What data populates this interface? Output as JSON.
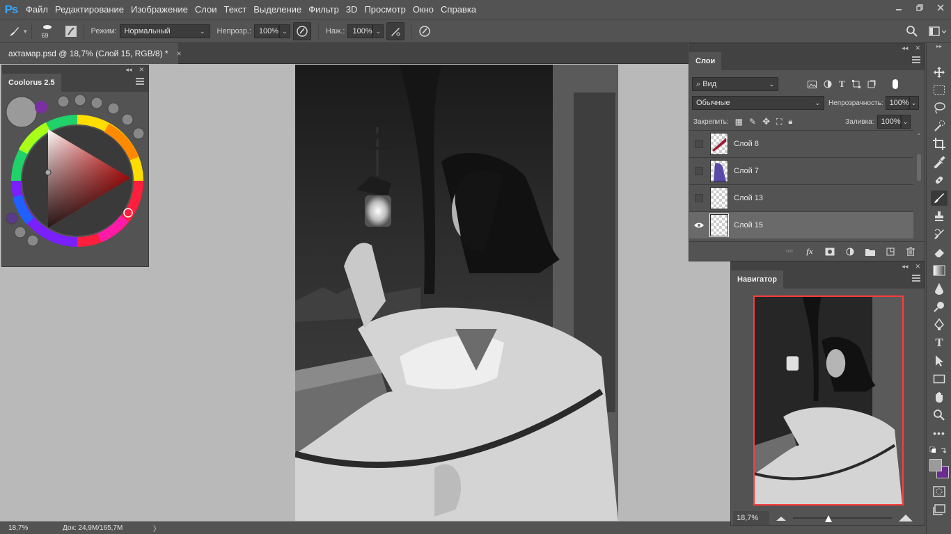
{
  "app": {
    "logo": "Ps",
    "menu": [
      "Файл",
      "Редактирование",
      "Изображение",
      "Слои",
      "Текст",
      "Выделение",
      "Фильтр",
      "3D",
      "Просмотр",
      "Окно",
      "Справка"
    ],
    "window_controls": [
      "minimize",
      "restore",
      "close"
    ]
  },
  "options_bar": {
    "brush_size": "69",
    "mode_label": "Режим:",
    "mode_value": "Нормальный",
    "opacity_label": "Непрозр.:",
    "opacity_value": "100%",
    "flow_label": "Наж.:",
    "flow_value": "100%"
  },
  "document": {
    "tab_title": "ахтамар.psd @ 18,7% (Слой 15, RGB/8) *",
    "close": "×"
  },
  "status_bar": {
    "zoom": "18,7%",
    "doc_size": "Док: 24,9M/165,7M",
    "arrow": "〉"
  },
  "coolorus": {
    "tab": "Coolorus 2.5",
    "current_color": "#9a9a9a",
    "secondary_color": "#7a2fa0"
  },
  "layers_panel": {
    "tab": "Слои",
    "filter_label": "Вид",
    "blend_mode": "Обычные",
    "opacity_label": "Непрозрачность:",
    "opacity_value": "100%",
    "lock_label": "Закрепить:",
    "fill_label": "Заливка:",
    "fill_value": "100%",
    "layers": [
      {
        "name": "Слой 8",
        "visible": false,
        "selected": false,
        "thumb": "red-stroke"
      },
      {
        "name": "Слой 7",
        "visible": false,
        "selected": false,
        "thumb": "blue-figure"
      },
      {
        "name": "Слой 13",
        "visible": false,
        "selected": false,
        "thumb": "transparent"
      },
      {
        "name": "Слой 15",
        "visible": true,
        "selected": true,
        "thumb": "transparent"
      }
    ]
  },
  "navigator": {
    "tab": "Навигатор",
    "zoom": "18,7%",
    "zoom_level": 0.35
  },
  "colors": {
    "foreground": "#9a9a9a",
    "background": "#6b2a8f",
    "accent": "#31a8ff",
    "nav_frame": "#ff3c3c"
  }
}
